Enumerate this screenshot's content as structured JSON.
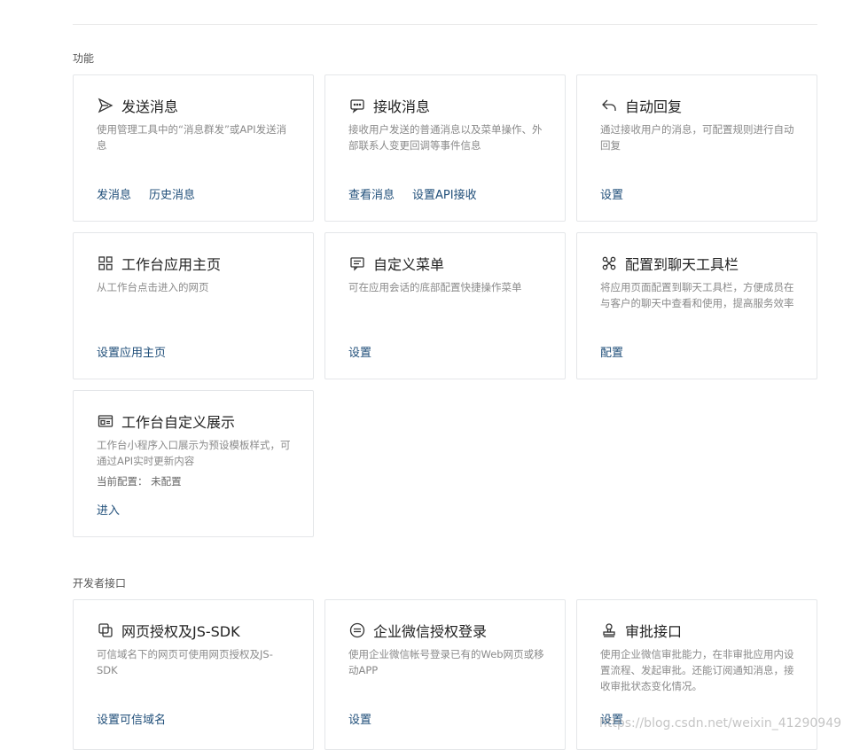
{
  "sections": {
    "features_title": "功能",
    "developer_title": "开发者接口"
  },
  "cards": [
    {
      "icon": "send-icon",
      "title": "发送消息",
      "desc": "使用管理工具中的“消息群发”或API发送消息",
      "links": [
        "发消息",
        "历史消息"
      ]
    },
    {
      "icon": "chat-bubble-icon",
      "title": "接收消息",
      "desc": "接收用户发送的普通消息以及菜单操作、外部联系人变更回调等事件信息",
      "links": [
        "查看消息",
        "设置API接收"
      ]
    },
    {
      "icon": "reply-icon",
      "title": "自动回复",
      "desc": "通过接收用户的消息，可配置规则进行自动回复",
      "links": [
        "设置"
      ]
    },
    {
      "icon": "grid-icon",
      "title": "工作台应用主页",
      "desc": "从工作台点击进入的网页",
      "links": [
        "设置应用主页"
      ]
    },
    {
      "icon": "menu-icon",
      "title": "自定义菜单",
      "desc": "可在应用会话的底部配置快捷操作菜单",
      "links": [
        "设置"
      ]
    },
    {
      "icon": "toolbar-icon",
      "title": "配置到聊天工具栏",
      "desc": "将应用页面配置到聊天工具栏，方便成员在与客户的聊天中查看和使用，提高服务效率",
      "links": [
        "配置"
      ]
    },
    {
      "icon": "id-card-icon",
      "title": "工作台自定义展示",
      "desc": "工作台小程序入口展示为预设模板样式，可通过API实时更新内容",
      "extra": "当前配置： 未配置",
      "links": [
        "进入"
      ]
    },
    {
      "icon": "web-auth-icon",
      "title": "网页授权及JS-SDK",
      "desc": "可信域名下的网页可使用网页授权及JS-SDK",
      "links": [
        "设置可信域名"
      ]
    },
    {
      "icon": "login-icon",
      "title": "企业微信授权登录",
      "desc": "使用企业微信帐号登录已有的Web网页或移动APP",
      "links": [
        "设置"
      ]
    },
    {
      "icon": "stamp-icon",
      "title": "审批接口",
      "desc": "使用企业微信审批能力，在非审批应用内设置流程、发起审批。还能订阅通知消息，接收审批状态变化情况。",
      "links": [
        "设置"
      ]
    }
  ],
  "watermark": "https://blog.csdn.net/weixin_41290949"
}
